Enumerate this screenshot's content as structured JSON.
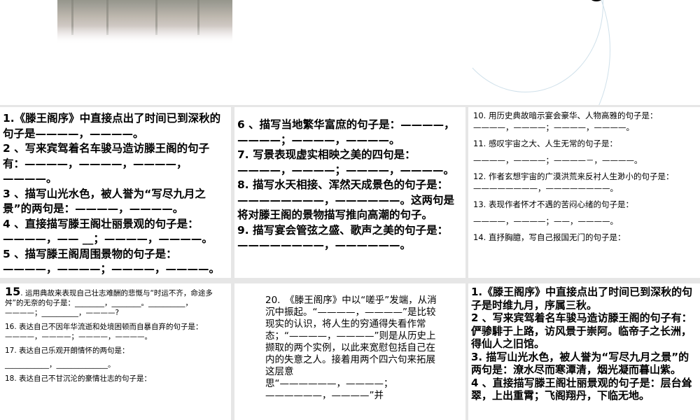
{
  "panels": {
    "p1": [
      " 1.《滕王阁序》中直接点出了时间已到深秋的句子是————，————。",
      "2 、写来宾驾着名车骏马造访滕王阁的句子有：————，————，————，————。",
      "3 、描写山光水色，被人誉为“写尽九月之景”的两句是：————，————。",
      "4 、直接描写滕王阁壮丽景观的句子是：————，—— __；————，————。",
      "5 、描写滕王阁周围景物的句子是：————，————；————，————。"
    ],
    "p2": [
      "6 、描写当地繁华富庶的句子是：————，————；————，————。",
      "7. 写景表现虚实相映之美的四句是：————，————；————，————。",
      "8. 描写水天相接、浑然天成景色的句子是：————————，——————。这两句是将对滕王阁的景物描写推向高潮的句子。",
      "9. 描写宴会管弦之盛、歌声之美的句子是：————————，——————。"
    ],
    "p3": [
      "10. 用历史典故暗示宴会豪华、人物高雅的句子是：————，————；————，————。",
      "11. 感叹宇宙之大、人生无常的句子是：",
      "————，————；————－，————。",
      "12. 作者玄想宇宙的广漠洪荒来反衬人生渺小的句子是：————————，————————。",
      "13. 表现作者怀才不遇的苦闷心绪的句子是：",
      "————，————；——，————。",
      "14. 直抒胸臆，写自己报国无门的句子是："
    ],
    "p4": {
      "num15": "15",
      "items": [
        ". 运用典故来表现自己壮志难酬的悲慨与“时运不齐，命途多舛”的无奈的句子是：________，________。__________，————；__________，————?",
        "16. 表达自己不因年华流逝和处境困顿而自暴自弃的句子是：————，————；————，————。",
        "17. 表达自己乐观开朗情怀的两句是：",
        "____________，______________。",
        "18. 表达自己不甘沉沦的豪情壮志的句子是："
      ]
    },
    "p5": [
      " 20.　《滕王阁序》中以“嗟乎”发端，从消沉中振起。“————，————”是比较现实的认识，将人生的穷通得失看作常",
      "态；“————，————”则是从历史上撷取的两个实例，以此来宽慰包括自己在内的失意之人。接着用两个四六句来拓展这层意",
      "思“——————，————；——————，————”并"
    ],
    "p6": [
      " 1.《滕王阁序》中直接点出了时间已到深秋的句子是时维九月，序属三秋。",
      "2 、写来宾驾着名车骏马造访滕王阁的句子有：俨骖騑于上路，访风景于崇阿。临帝子之长洲，得仙人之旧馆。",
      "3. 描写山光水色，被人誉为“写尽九月之景”的两句是：潦水尽而寒潭清，烟光凝而暮山紫。",
      "4 、直接描写滕王阁壮丽景观的句子是：层台耸翠，上出重霄；飞阁翔丹，下临无地。"
    ]
  }
}
